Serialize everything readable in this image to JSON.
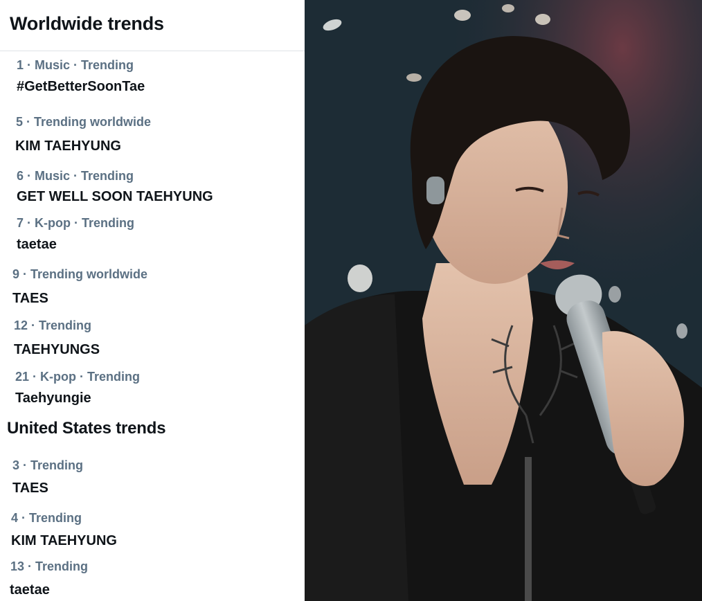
{
  "worldwide": {
    "title": "Worldwide trends",
    "trends": [
      {
        "meta": "1 · Music · Trending",
        "name": "#GetBetterSoonTae"
      },
      {
        "meta": "5 · Trending worldwide",
        "name": "KIM TAEHYUNG"
      },
      {
        "meta": "6 · Music · Trending",
        "name": "GET WELL SOON TAEHYUNG"
      },
      {
        "meta": "7 · K-pop · Trending",
        "name": "taetae"
      },
      {
        "meta": "9 · Trending worldwide",
        "name": "TAES"
      },
      {
        "meta": "12 · Trending",
        "name": "TAEHYUNGS"
      },
      {
        "meta": "21 · K-pop · Trending",
        "name": "Taehyungie"
      }
    ]
  },
  "united_states": {
    "title": "United States trends",
    "trends": [
      {
        "meta": "3 · Trending",
        "name": "TAES"
      },
      {
        "meta": "4 · Trending",
        "name": "KIM TAEHYUNG"
      },
      {
        "meta": "13 · Trending",
        "name": "taetae"
      }
    ]
  },
  "colors": {
    "heading_text": "#0f1419",
    "meta_text": "#5b7083",
    "divider": "#dfe3e6",
    "photo_background": "#1d2c35"
  }
}
